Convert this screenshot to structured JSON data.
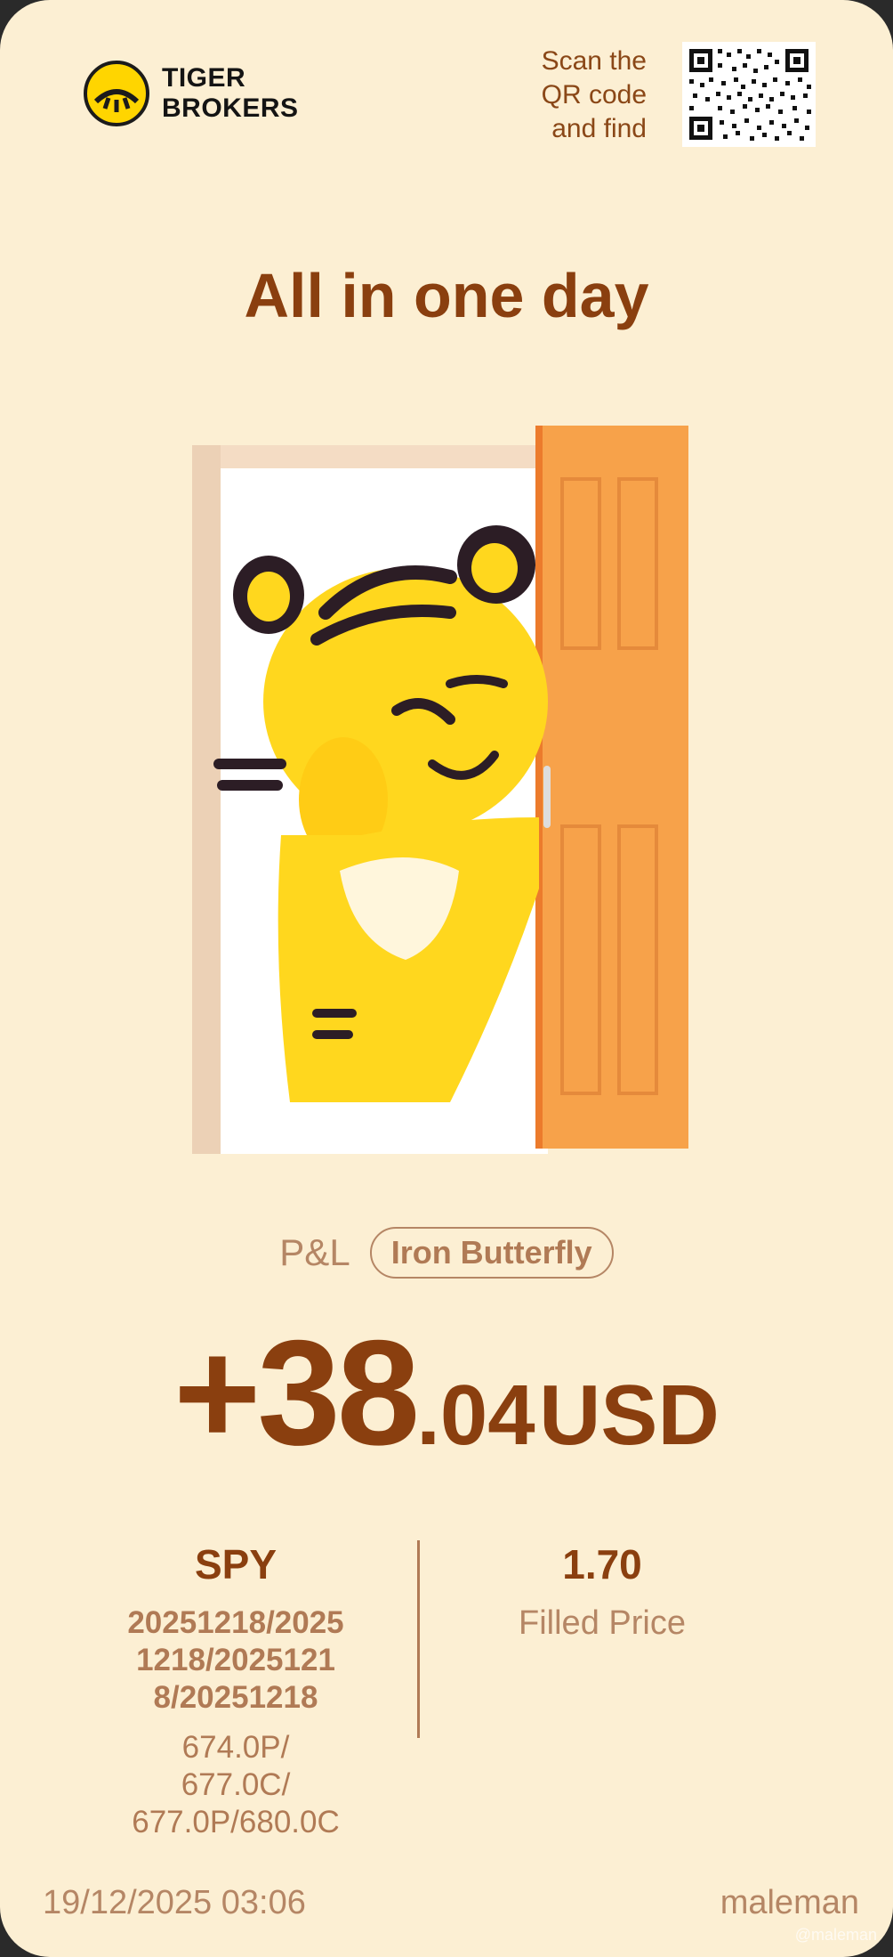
{
  "brand": {
    "line1": "TIGER",
    "line2": "BROKERS"
  },
  "scan": {
    "line1": "Scan the",
    "line2": "QR code",
    "line3": "and find"
  },
  "headline": "All in one day",
  "pl": {
    "label": "P&L",
    "strategy": "Iron Butterfly",
    "amount_int": "+38",
    "amount_dec": ".04",
    "currency": "USD"
  },
  "trade": {
    "symbol": "SPY",
    "expiry": "20251218/20251218/20251218/20251218",
    "strikes": [
      "674.0P/",
      "677.0C/",
      "677.0P/680.0C"
    ],
    "price": "1.70",
    "price_label": "Filled Price"
  },
  "footer": {
    "timestamp": "19/12/2025 03:06",
    "author": "maleman",
    "watermark": "@maleman"
  },
  "colors": {
    "background": "#fcefd3",
    "accent": "#8a3f0f",
    "muted": "#b58665",
    "logo": "#ffd500"
  }
}
